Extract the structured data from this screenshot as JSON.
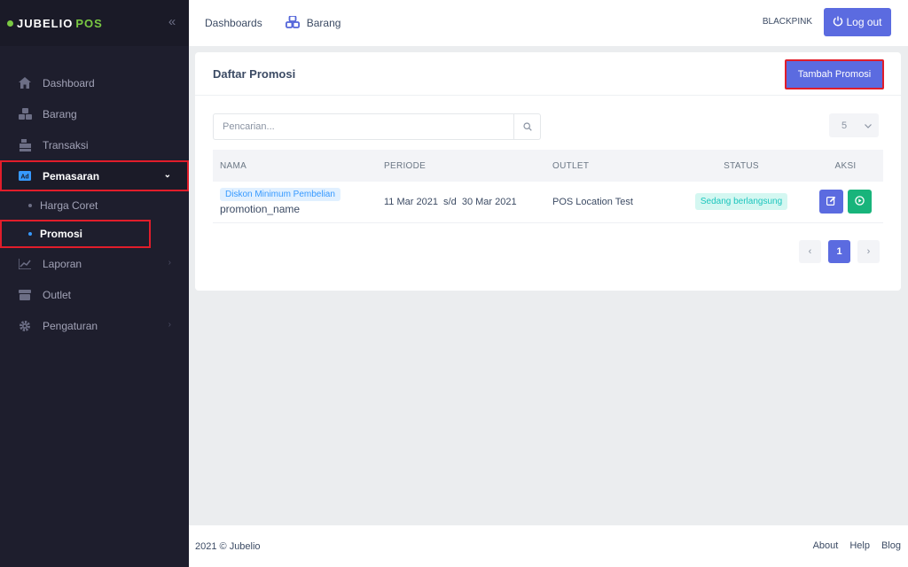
{
  "brand": {
    "name": "JUBELIO",
    "suffix": "POS"
  },
  "sidebar": {
    "items": [
      {
        "label": "Dashboard",
        "icon": "home-icon"
      },
      {
        "label": "Barang",
        "icon": "cubes-icon"
      },
      {
        "label": "Transaksi",
        "icon": "cash-register-icon"
      },
      {
        "label": "Pemasaran",
        "icon": "ad-icon"
      },
      {
        "label": "Laporan",
        "icon": "chart-line-icon"
      },
      {
        "label": "Outlet",
        "icon": "store-icon"
      },
      {
        "label": "Pengaturan",
        "icon": "gear-icon"
      }
    ],
    "submenu": [
      {
        "label": "Harga Coret"
      },
      {
        "label": "Promosi"
      }
    ]
  },
  "topbar": {
    "links": [
      {
        "label": "Dashboards"
      },
      {
        "label": "Barang"
      }
    ],
    "user": "BLACKPINK",
    "logout_label": "Log out"
  },
  "card": {
    "title": "Daftar Promosi",
    "add_button": "Tambah Promosi",
    "search_placeholder": "Pencarian...",
    "per_page": "5",
    "columns": [
      "NAMA",
      "PERIODE",
      "OUTLET",
      "STATUS",
      "AKSI"
    ],
    "rows": [
      {
        "type": "Diskon Minimum Pembelian",
        "name": "promotion_name",
        "period": "11 Mar 2021  s/d  30 Mar 2021",
        "outlet": "POS Location Test",
        "status": "Sedang berlangsung"
      }
    ],
    "pagination": {
      "prev": "‹",
      "current": "1",
      "next": "›"
    }
  },
  "footer": {
    "copyright": "2021 © Jubelio",
    "links": [
      "About",
      "Help",
      "Blog"
    ]
  },
  "colors": {
    "sidebar_bg": "#1e1e2d",
    "primary": "#5b6be0",
    "success": "#18b47b",
    "highlight": "#e11d2a"
  }
}
